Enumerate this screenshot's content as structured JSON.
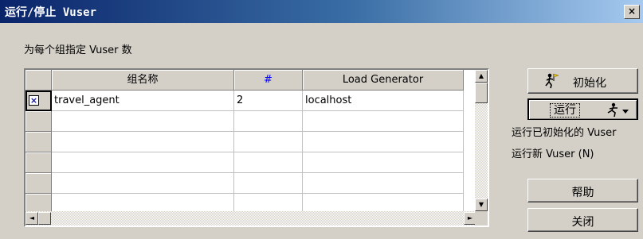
{
  "window": {
    "title": "运行/停止 Vuser",
    "close_label": "×"
  },
  "prompt": "为每个组指定 Vuser 数",
  "grid": {
    "columns": [
      "组名称",
      "#",
      "Load Generator"
    ],
    "rows": [
      {
        "checked": true,
        "check_mark": "×",
        "name": "travel_agent",
        "count": "2",
        "generator": "localhost"
      },
      {
        "name": "",
        "count": "",
        "generator": ""
      },
      {
        "name": "",
        "count": "",
        "generator": ""
      },
      {
        "name": "",
        "count": "",
        "generator": ""
      },
      {
        "name": "",
        "count": "",
        "generator": ""
      },
      {
        "name": "",
        "count": "",
        "generator": ""
      }
    ]
  },
  "buttons": {
    "init": "初始化",
    "run": "运行",
    "help": "帮助",
    "close": "关闭"
  },
  "run_menu": {
    "run_initialized": "运行已初始化的 Vuser",
    "run_new": "运行新 Vuser (N)"
  },
  "scrollbar": {
    "up": "▲",
    "down": "▼",
    "left": "◄",
    "right": "►"
  },
  "colors": {
    "title_bar_start": "#0a246a",
    "title_bar_end": "#a6caf0",
    "face": "#d4d0c8",
    "num_header": "#0000ff"
  }
}
